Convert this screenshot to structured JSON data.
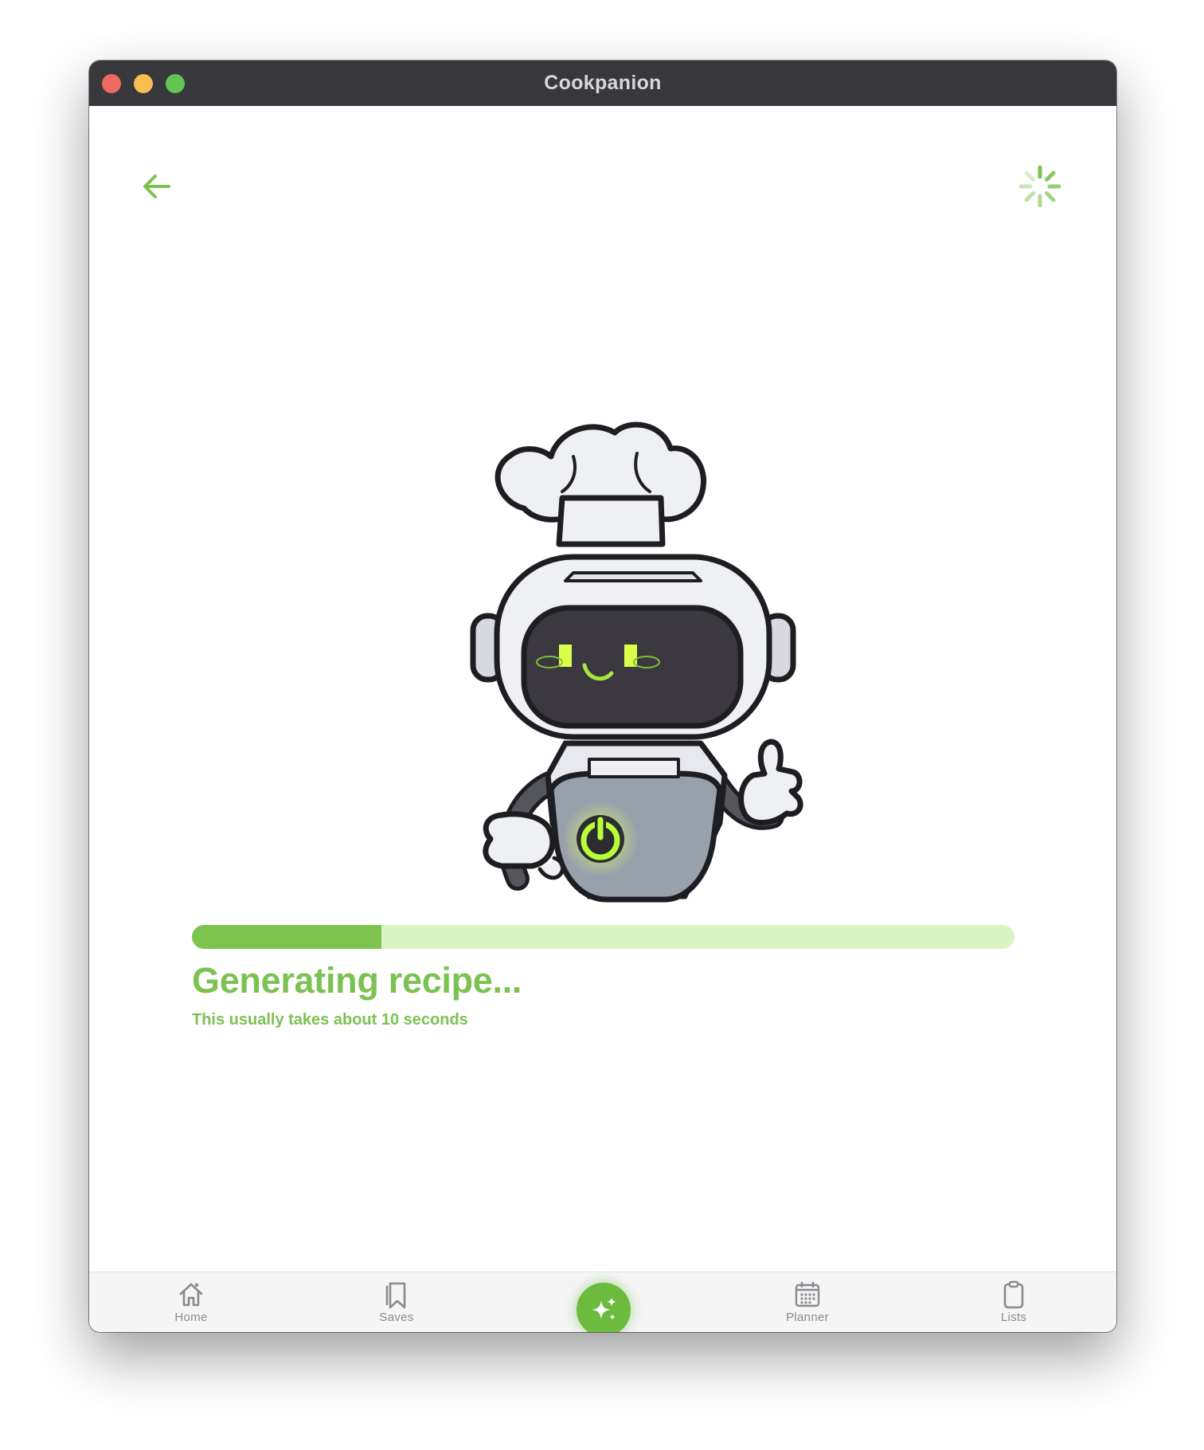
{
  "window": {
    "title": "Cookpanion"
  },
  "header": {
    "back_icon": "arrow-left-icon",
    "activity_icon": "spinner-icon"
  },
  "generation": {
    "title": "Generating recipe...",
    "subtitle": "This usually takes about 10 seconds",
    "progress_fraction": 0.23
  },
  "tabbar": {
    "items": [
      {
        "label": "Home",
        "icon": "home-icon"
      },
      {
        "label": "Saves",
        "icon": "bookmark-icon"
      },
      {
        "label": "",
        "icon": "sparkles-icon"
      },
      {
        "label": "Planner",
        "icon": "calendar-icon"
      },
      {
        "label": "Lists",
        "icon": "clipboard-icon"
      }
    ]
  },
  "colors": {
    "accent": "#7bc252",
    "progress_track": "#dcf3c4",
    "titlebar": "#38373c",
    "tab_inactive": "#8a8a8e"
  }
}
